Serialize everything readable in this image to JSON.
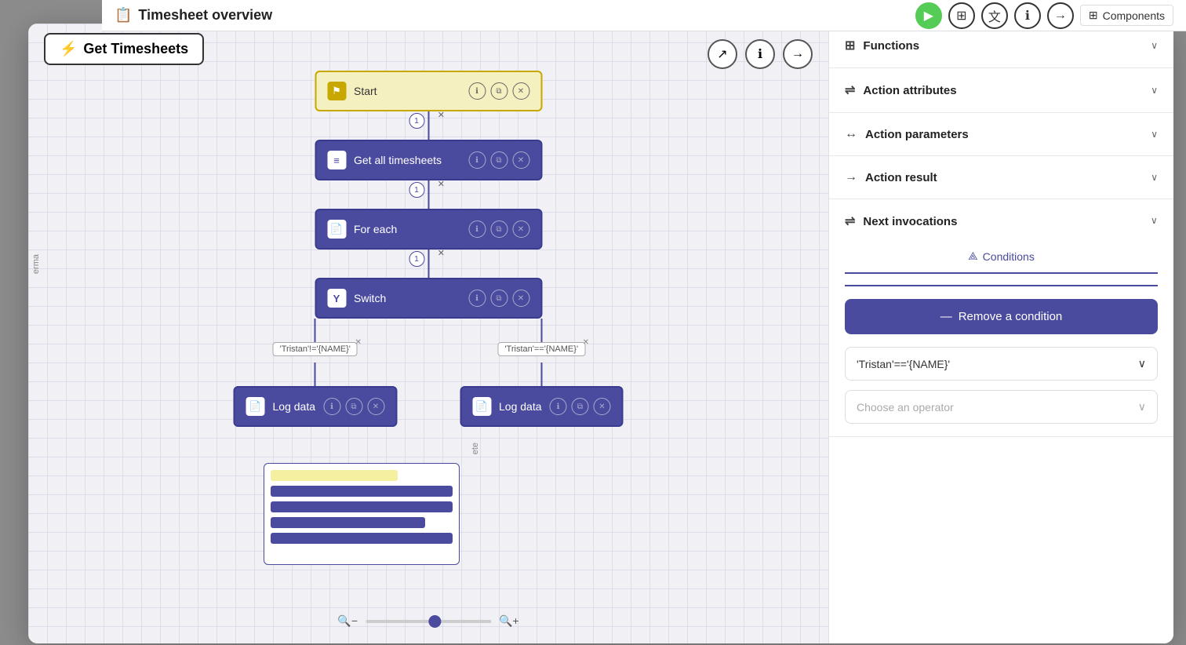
{
  "page": {
    "title": "Timesheet overview",
    "title_icon": "📋"
  },
  "top_bar": {
    "play_label": "▶",
    "grid_label": "⊞",
    "translate_label": "文",
    "info_label": "ℹ",
    "arrow_label": "→",
    "components_label": "Components"
  },
  "function_title": {
    "icon": "⚡",
    "label": "Get Timesheets"
  },
  "canvas": {
    "controls": {
      "expand": "↗",
      "info": "ℹ",
      "arrow": "→"
    }
  },
  "nodes": [
    {
      "id": "start",
      "label": "Start",
      "type": "start",
      "icon": "⚑"
    },
    {
      "id": "get-all-timesheets",
      "label": "Get all timesheets",
      "type": "action",
      "icon": "≡"
    },
    {
      "id": "for-each",
      "label": "For each",
      "type": "action",
      "icon": "📄"
    },
    {
      "id": "switch",
      "label": "Switch",
      "type": "switch",
      "icon": "Y"
    }
  ],
  "branches": [
    {
      "label": "'Tristan'!='{NAME}'",
      "log": "Log data"
    },
    {
      "label": "'Tristan'=='{NAME}'",
      "log": "Log data"
    }
  ],
  "zoom": {
    "min_icon": "🔍",
    "max_icon": "🔍",
    "value": 55
  },
  "right_panel": {
    "sections": [
      {
        "id": "functions",
        "icon": "⊞",
        "label": "Functions",
        "expanded": false
      },
      {
        "id": "action-attributes",
        "icon": "⇌",
        "label": "Action attributes",
        "expanded": false
      },
      {
        "id": "action-parameters",
        "icon": "↔",
        "label": "Action parameters",
        "expanded": false
      },
      {
        "id": "action-result",
        "icon": "→",
        "label": "Action result",
        "expanded": false
      },
      {
        "id": "next-invocations",
        "icon": "⇌",
        "label": "Next invocations",
        "expanded": true
      }
    ],
    "next_invocations": {
      "conditions_tab": "Conditions",
      "conditions_icon": "⟁",
      "remove_condition_btn": "Remove a condition",
      "remove_icon": "—",
      "condition_value": "'Tristan'=='{NAME}'",
      "operator_placeholder": "Choose an operator",
      "operator_chevron": "▾"
    }
  },
  "sidebar": {
    "erma_label": "erma",
    "ete_label": "ete"
  }
}
